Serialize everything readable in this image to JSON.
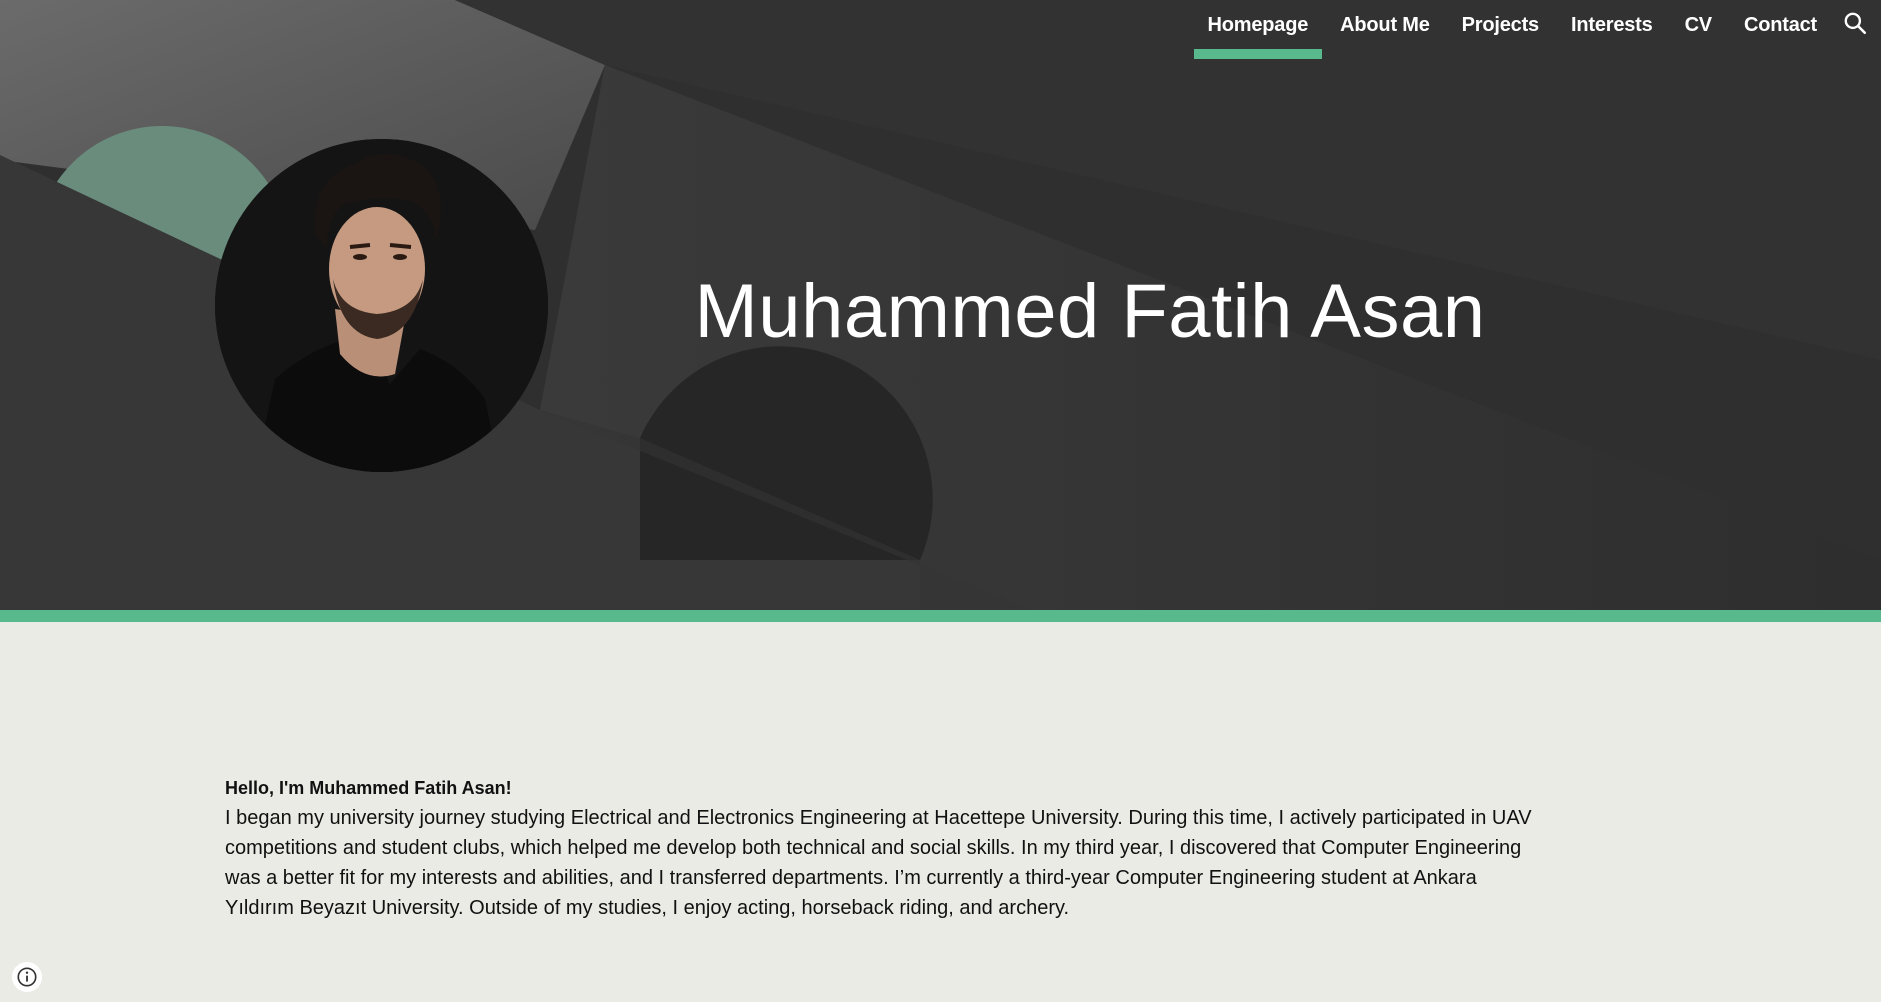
{
  "nav": {
    "items": [
      {
        "label": "Homepage",
        "active": true
      },
      {
        "label": "About Me",
        "active": false
      },
      {
        "label": "Projects",
        "active": false
      },
      {
        "label": "Interests",
        "active": false
      },
      {
        "label": "CV",
        "active": false
      },
      {
        "label": "Contact",
        "active": false
      }
    ],
    "search_icon": "search-icon"
  },
  "hero": {
    "title": "Muhammed Fatih Asan",
    "avatar_alt": "Portrait photo"
  },
  "main": {
    "greeting": "Hello, I'm Muhammed Fatih Asan!",
    "bio": "I began my university journey studying Electrical and Electronics Engineering at Hacettepe University. During this time, I actively participated in UAV competitions and student clubs, which helped me develop both technical and social skills. In my third year, I discovered that Computer Engineering was a better fit for my interests and abilities, and I transferred departments. I’m currently a third-year Computer Engineering student at Ankara Yıldırım Beyazıt University. Outside of my studies, I enjoy acting, horseback riding, and archery."
  },
  "footer": {
    "info_icon": "info-icon"
  },
  "colors": {
    "accent": "#57b98c",
    "hero_bg": "#2d2d2d",
    "content_bg": "#ebebe6"
  }
}
